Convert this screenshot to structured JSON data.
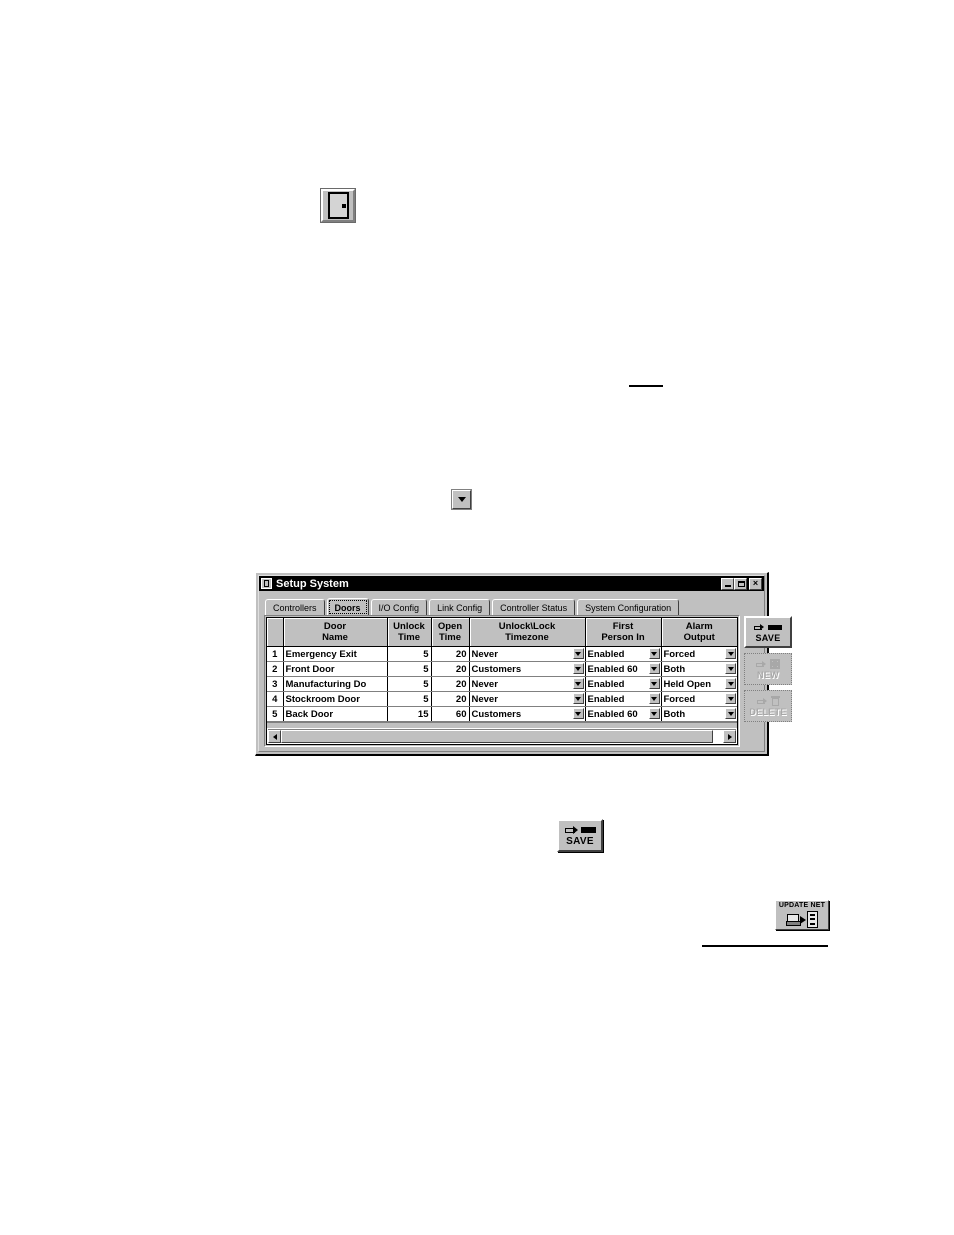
{
  "figures": {
    "door_icon": {
      "name": "door-toolbar-icon"
    },
    "combo_icon": {
      "name": "dropdown-arrow-button"
    },
    "save_icon": {
      "label": "SAVE"
    },
    "update_net_icon": {
      "label": "UPDATE NET"
    }
  },
  "window": {
    "title": "Setup System",
    "sysmenu_icon": "door-system-menu-icon",
    "controls": {
      "minimize": "_",
      "maximize": "□",
      "close": "×"
    },
    "tabs": [
      {
        "label": "Controllers",
        "active": false
      },
      {
        "label": "Doors",
        "active": true
      },
      {
        "label": "I/O Config",
        "active": false
      },
      {
        "label": "Link Config",
        "active": false
      },
      {
        "label": "Controller Status",
        "active": false
      },
      {
        "label": "System Configuration",
        "active": false
      }
    ],
    "grid": {
      "columns": [
        {
          "id": "rownum",
          "label": ""
        },
        {
          "id": "door_name",
          "label": "Door\nName"
        },
        {
          "id": "unlock_time",
          "label": "Unlock\nTime"
        },
        {
          "id": "open_time",
          "label": "Open\nTime"
        },
        {
          "id": "unlock_lock_timezone",
          "label": "Unlock\\Lock\nTimezone"
        },
        {
          "id": "first_person_in",
          "label": "First\nPerson In"
        },
        {
          "id": "alarm_output",
          "label": "Alarm\nOutput"
        }
      ],
      "column_labels": {
        "door_name_l1": "Door",
        "door_name_l2": "Name",
        "unlock_time_l1": "Unlock",
        "unlock_time_l2": "Time",
        "open_time_l1": "Open",
        "open_time_l2": "Time",
        "timezone_l1": "Unlock\\Lock",
        "timezone_l2": "Timezone",
        "first_person_l1": "First",
        "first_person_l2": "Person In",
        "alarm_l1": "Alarm",
        "alarm_l2": "Output"
      },
      "rows": [
        {
          "num": "1",
          "door_name": "Emergency Exit",
          "unlock_time": "5",
          "open_time": "20",
          "timezone": "Never",
          "first_person_in": "Enabled",
          "first_person_in_disabled": true,
          "alarm_output": "Forced"
        },
        {
          "num": "2",
          "door_name": "Front Door",
          "unlock_time": "5",
          "open_time": "20",
          "timezone": "Customers",
          "first_person_in": "Enabled 60",
          "first_person_in_disabled": false,
          "alarm_output": "Both"
        },
        {
          "num": "3",
          "door_name": "Manufacturing Do",
          "unlock_time": "5",
          "open_time": "20",
          "timezone": "Never",
          "first_person_in": "Enabled",
          "first_person_in_disabled": true,
          "alarm_output": "Held Open"
        },
        {
          "num": "4",
          "door_name": "Stockroom Door",
          "unlock_time": "5",
          "open_time": "20",
          "timezone": "Never",
          "first_person_in": "Enabled",
          "first_person_in_disabled": true,
          "alarm_output": "Forced"
        },
        {
          "num": "5",
          "door_name": "Back Door",
          "unlock_time": "15",
          "open_time": "60",
          "timezone": "Customers",
          "first_person_in": "Enabled 60",
          "first_person_in_disabled": false,
          "alarm_output": "Both"
        }
      ]
    },
    "buttons": {
      "save": {
        "label": "SAVE",
        "enabled": true
      },
      "new": {
        "label": "NEW",
        "enabled": false
      },
      "delete": {
        "label": "DELETE",
        "enabled": false
      }
    }
  },
  "colors": {
    "face": "#c0c0c0",
    "titlebar": "#000000",
    "title_text": "#ffffff",
    "grid_bg": "#ffffff",
    "disabled_text": "#808080"
  }
}
